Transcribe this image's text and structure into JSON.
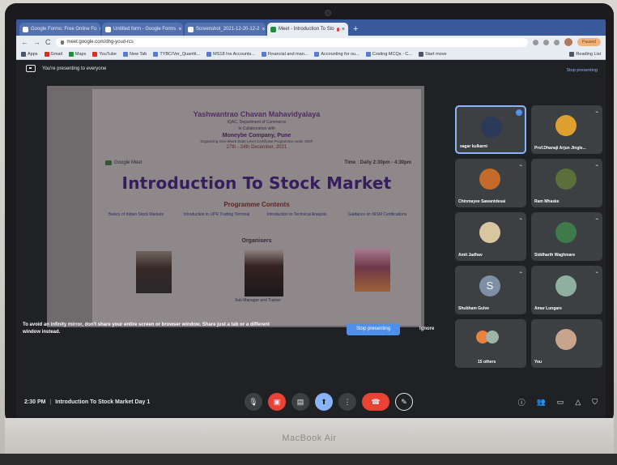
{
  "browser": {
    "tabs": [
      {
        "label": "Google Forms: Free Online Fo",
        "active": false
      },
      {
        "label": "Untitled form - Google Forms",
        "active": false
      },
      {
        "label": "Screenshot_2021-12-20-12-2",
        "active": false
      },
      {
        "label": "Meet - Introduction To Sto",
        "active": true
      }
    ],
    "address": "meet.google.com/dhg-ycud-rcs",
    "bookmarks": [
      "Apps",
      "Gmail",
      "Maps",
      "YouTube",
      "New Tab",
      "TYBC/Ver_Quantit...",
      "MS18 Ins Accounts...",
      "Financial and man...",
      "Accounting for ou...",
      "Costing MCQs - C...",
      "Start move"
    ],
    "reading_list": "Reading List",
    "paused_label": "Paused"
  },
  "meet": {
    "presenting_banner": "You're presenting to everyone",
    "stop_presenting_link": "Stop presenting",
    "warning_text": "To avoid an infinity mirror, don't share your entire screen or browser window. Share just a tab or a different window instead.",
    "stop_presenting_button": "Stop presenting",
    "ignore_button": "Ignore",
    "meeting_time": "2:30 PM",
    "meeting_title": "Introduction To Stock Market Day 1",
    "others_count_label": "15 others",
    "you_label": "You"
  },
  "participants": [
    {
      "name": "sagar kulkarni",
      "avatar_color": "#2c3a5a",
      "speaking": true
    },
    {
      "name": "Prof.Dhanaji Arjun Jingle...",
      "avatar_color": "#e0a030"
    },
    {
      "name": "Chinmayee Sawantdesai",
      "avatar_color": "#c46a2a"
    },
    {
      "name": "Ram Mhaske",
      "avatar_color": "#5a6f3a"
    },
    {
      "name": "Amit Jadhav",
      "avatar_color": "#d8c6a0"
    },
    {
      "name": "Siddharth Waghmare",
      "avatar_color": "#3f7a4a"
    },
    {
      "name": "Shubham Gulve",
      "avatar_letter": "S",
      "avatar_color": "#7f8fa6"
    },
    {
      "name": "Amar Lungare",
      "avatar_color": "#8fb0a0"
    }
  ],
  "poster": {
    "institution": "Yashwantrao Chavan Mahavidyalaya",
    "sub1": "IQAC, Department of Commerce",
    "sub2": "In Collaboration with",
    "organisation": "Moneybe Company, Pune",
    "program": "Organizing One-Week State Level Certificate Programme under ISDP",
    "dates": "27th - 24th December, 2021",
    "meet_label": "Google Meet",
    "time": "Time : Daily 2:30pm - 4:30pm",
    "title": "Introduction To Stock Market",
    "contents_heading": "Programme Contents",
    "contents": [
      "Basics of Indian Stock Markets",
      "Introduction to UPR Trading Terminal",
      "Introduction to Technical Analysis",
      "Guidance on NISM Certifications"
    ],
    "organisers_heading": "Organisers",
    "caption_mid": "Sub Manager and Trainer"
  },
  "colors": {
    "meet_bg": "#202124",
    "accent_blue": "#8ab4f8",
    "end_call_red": "#ea4335",
    "tab_bar": "#3b5a9c"
  },
  "controls": {
    "icons": [
      "mic-icon",
      "camera-off-icon",
      "captions-icon",
      "present-icon",
      "more-options-icon",
      "end-call-icon",
      "pen-icon"
    ],
    "right_icons": [
      "info-icon",
      "people-icon",
      "chat-icon",
      "activities-icon",
      "host-controls-icon"
    ]
  }
}
